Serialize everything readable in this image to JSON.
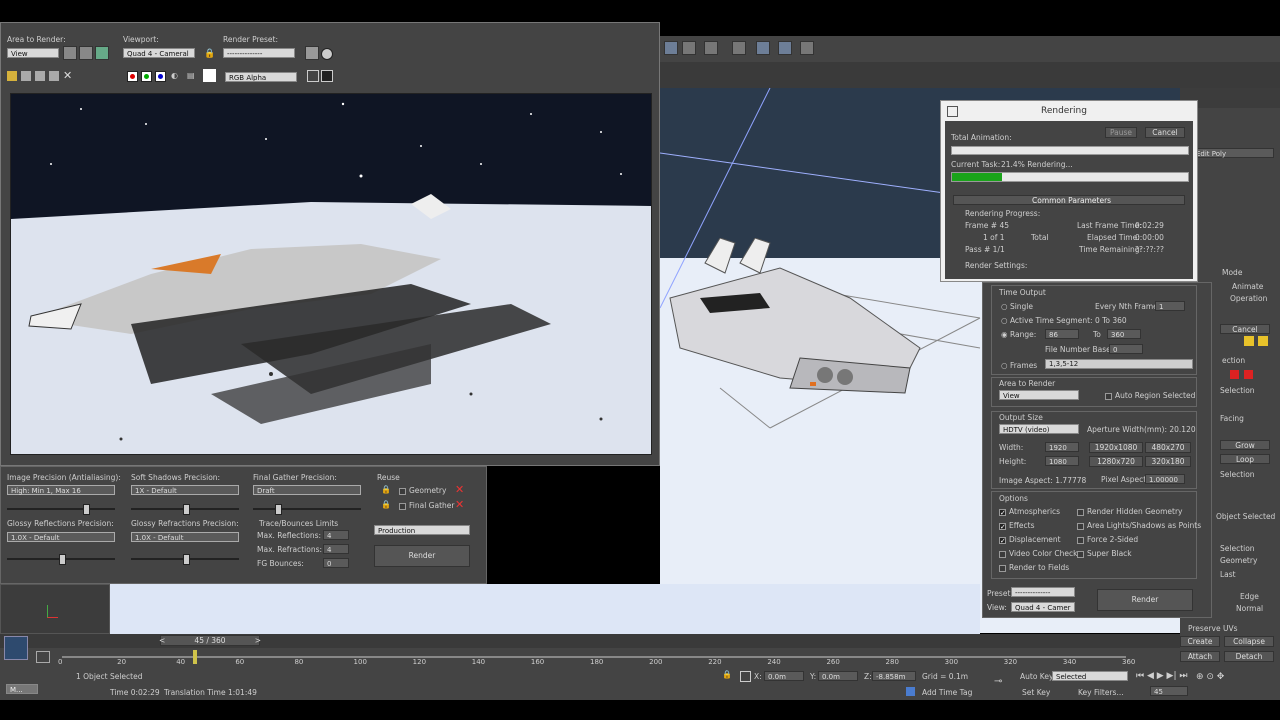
{
  "frame_window": {
    "area_label": "Area to Render:",
    "area_value": "View",
    "viewport_label": "Viewport:",
    "viewport_value": "Quad 4 - Cameral",
    "preset_label": "Render Preset:",
    "preset_value": "--------------",
    "channel_value": "RGB Alpha"
  },
  "mr_panel": {
    "image_precision_label": "Image Precision (Antialiasing):",
    "image_precision_value": "High: Min 1, Max 16",
    "soft_shadows_label": "Soft Shadows Precision:",
    "soft_shadows_value": "1X - Default",
    "final_gather_label": "Final Gather Precision:",
    "final_gather_value": "Draft",
    "reuse_label": "Reuse",
    "geometry_label": "Geometry",
    "final_gather_reuse_label": "Final Gather",
    "glossy_reflections_label": "Glossy Reflections Precision:",
    "glossy_reflections_value": "1.0X - Default",
    "glossy_refractions_label": "Glossy Refractions Precision:",
    "glossy_refractions_value": "1.0X - Default",
    "trace_label": "Trace/Bounces Limits",
    "max_reflections_label": "Max. Reflections:",
    "max_reflections_value": "4",
    "max_refractions_label": "Max. Refractions:",
    "max_refractions_value": "4",
    "fg_bounces_label": "FG Bounces:",
    "fg_bounces_value": "0",
    "production_value": "Production",
    "render_button": "Render"
  },
  "rendering_dialog": {
    "title": "Rendering",
    "total_animation_label": "Total Animation:",
    "pause_button": "Pause",
    "cancel_button": "Cancel",
    "current_task_label": "Current Task:",
    "current_task_value": "21.4%  Rendering...",
    "current_task_progress": 0.21,
    "common_params_label": "Common Parameters",
    "rendering_progress_label": "Rendering Progress:",
    "frame_label": "Frame #",
    "frame_value": "45",
    "of_value": "1 of 1",
    "total_label": "Total",
    "pass_label": "Pass #",
    "pass_value": "1/1",
    "last_frame_time_label": "Last Frame Time:",
    "last_frame_time_value": "0:02:29",
    "elapsed_time_label": "Elapsed Time:",
    "elapsed_time_value": "0:00:00",
    "time_remaining_label": "Time Remaining:",
    "time_remaining_value": "??:??:??",
    "render_settings_label": "Render Settings:"
  },
  "render_setup": {
    "time_output_label": "Time Output",
    "single_label": "Single",
    "every_nth_label": "Every Nth Frame:",
    "every_nth_value": "1",
    "active_segment_label": "Active Time Segment:",
    "active_segment_value": "0 To 360",
    "range_label": "Range:",
    "range_from": "86",
    "range_to_label": "To",
    "range_to": "360",
    "file_number_base_label": "File Number Base:",
    "file_number_base_value": "0",
    "frames_label": "Frames",
    "frames_value": "1,3,5-12",
    "area_label": "Area to Render",
    "area_value": "View",
    "auto_region_label": "Auto Region Selected",
    "output_size_label": "Output Size",
    "output_size_value": "HDTV (video)",
    "aperture_label": "Aperture Width(mm): 20.120",
    "width_label": "Width:",
    "width_value": "1920",
    "height_label": "Height:",
    "height_value": "1080",
    "presets": [
      "1920x1080",
      "480x270",
      "1280x720",
      "320x180"
    ],
    "image_aspect": "Image Aspect: 1.77778",
    "pixel_aspect_label": "Pixel Aspect:",
    "pixel_aspect_value": "1.00000",
    "options_label": "Options",
    "options": [
      {
        "label": "Atmospherics",
        "checked": true
      },
      {
        "label": "Render Hidden Geometry",
        "checked": false
      },
      {
        "label": "Effects",
        "checked": true
      },
      {
        "label": "Area Lights/Shadows as Points",
        "checked": false
      },
      {
        "label": "Displacement",
        "checked": true
      },
      {
        "label": "Force 2-Sided",
        "checked": false
      },
      {
        "label": "Video Color Check",
        "checked": false
      },
      {
        "label": "Super Black",
        "checked": false
      },
      {
        "label": "Render to Fields",
        "checked": false
      }
    ],
    "preset_label": "Preset:",
    "preset_value": "--------------",
    "view_label": "View:",
    "view_value": "Quad 4 - Camer",
    "render_button": "Render"
  },
  "command_panel": {
    "items": [
      "Edit Poly",
      "Mode",
      "Animate",
      "Operation",
      "Cancel",
      "ection",
      "Selection",
      "Facing",
      "Grow",
      "Loop",
      "Selection",
      "Object Selected",
      "Selection",
      "Geometry",
      "Last",
      "Edge",
      "Normal",
      "Preserve UVs",
      "Create",
      "Collapse",
      "Attach",
      "Detach"
    ]
  },
  "timeline": {
    "frame_counter": "45 / 360",
    "ticks": [
      "0",
      "20",
      "40",
      "60",
      "80",
      "100",
      "120",
      "140",
      "160",
      "180",
      "200",
      "220",
      "240",
      "260",
      "280",
      "300",
      "320",
      "340",
      "360"
    ],
    "current_frame": 45,
    "max_frame": 360
  },
  "status_bar": {
    "status_text": "1 Object Selected",
    "time_text": "Time  0:02:29",
    "translation_text": "Translation Time  1:01:49",
    "x_label": "X:",
    "x_value": "0.0m",
    "y_label": "Y:",
    "y_value": "0.0m",
    "z_label": "Z:",
    "z_value": "-8.858m",
    "grid_text": "Grid = 0.1m",
    "add_time_tag": "Add Time Tag",
    "auto_key_label": "Auto Key",
    "auto_key_value": "Selected",
    "set_key_label": "Set Key",
    "key_filters_label": "Key Filters...",
    "frame_value": "45",
    "maxscript_label": "M..."
  },
  "colors": {
    "viewport_sky": "#0f1524",
    "snow": "#dde3ee",
    "panel_bg": "#444444",
    "progress_green": "#1aa31a",
    "dialog_bg": "#f0f0f0"
  }
}
